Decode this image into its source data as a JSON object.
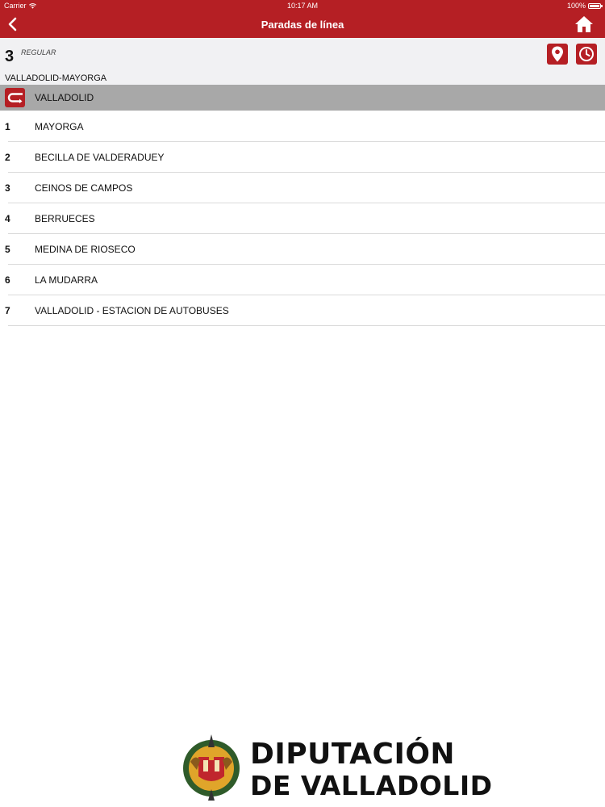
{
  "status_bar": {
    "carrier": "Carrier",
    "time": "10:17 AM",
    "battery": "100%"
  },
  "nav": {
    "title": "Paradas de línea",
    "back_icon": "chevron-left-icon",
    "home_icon": "home-icon"
  },
  "line": {
    "number": "3",
    "type": "REGULAR",
    "route": "VALLADOLID-MAYORGA",
    "map_icon": "map-pin-icon",
    "schedule_icon": "clock-icon"
  },
  "origin": {
    "name": "VALLADOLID",
    "icon": "return-route-icon"
  },
  "stops": [
    {
      "num": "1",
      "name": "MAYORGA"
    },
    {
      "num": "2",
      "name": "BECILLA DE VALDERADUEY"
    },
    {
      "num": "3",
      "name": "CEINOS DE CAMPOS"
    },
    {
      "num": "4",
      "name": "BERRUECES"
    },
    {
      "num": "5",
      "name": "MEDINA DE RIOSECO"
    },
    {
      "num": "6",
      "name": "LA MUDARRA"
    },
    {
      "num": "7",
      "name": "VALLADOLID - ESTACION DE AUTOBUSES"
    }
  ],
  "footer": {
    "logo_line1": "DIPUTACIÓN",
    "logo_line2": "DE VALLADOLID"
  },
  "colors": {
    "brand_red": "#b51f24",
    "origin_row_gray": "#a8a8a8",
    "header_bg": "#f1f1f3"
  }
}
